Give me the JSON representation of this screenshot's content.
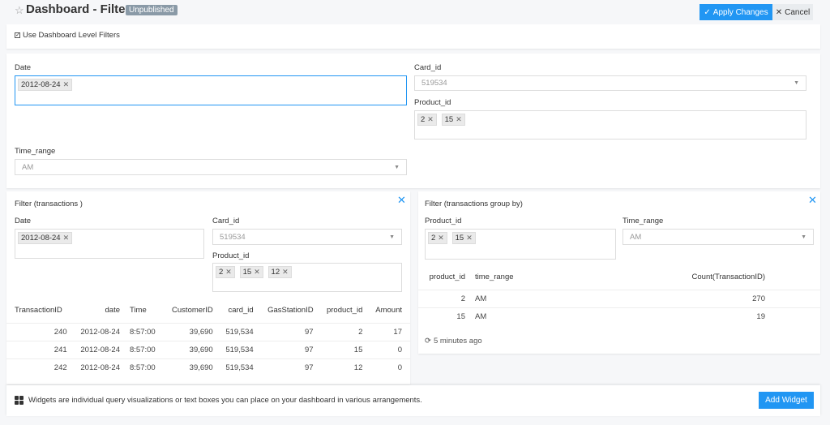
{
  "header": {
    "title": "Dashboard - Filter",
    "badge": "Unpublished",
    "apply_label": "Apply Changes",
    "cancel_label": "Cancel"
  },
  "dashboard_filters": {
    "checkbox_label": "Use Dashboard Level Filters",
    "date_label": "Date",
    "date_tags": [
      "2012-08-24"
    ],
    "card_id_label": "Card_id",
    "card_id_value": "519534",
    "product_id_label": "Product_id",
    "product_id_tags": [
      "2",
      "15"
    ],
    "time_range_label": "Time_range",
    "time_range_value": "AM"
  },
  "widget_left": {
    "title": "Filter (transactions )",
    "date_label": "Date",
    "date_tags": [
      "2012-08-24"
    ],
    "card_id_label": "Card_id",
    "card_id_value": "519534",
    "product_id_label": "Product_id",
    "product_id_tags": [
      "2",
      "15",
      "12"
    ],
    "columns": [
      "TransactionID",
      "date",
      "Time",
      "CustomerID",
      "card_id",
      "GasStationID",
      "product_id",
      "Amount"
    ],
    "rows": [
      [
        "240",
        "2012-08-24",
        "8:57:00",
        "39,690",
        "519,534",
        "97",
        "2",
        "17"
      ],
      [
        "241",
        "2012-08-24",
        "8:57:00",
        "39,690",
        "519,534",
        "97",
        "15",
        "0"
      ],
      [
        "242",
        "2012-08-24",
        "8:57:00",
        "39,690",
        "519,534",
        "97",
        "12",
        "0"
      ]
    ]
  },
  "widget_right": {
    "title": "Filter (transactions group by)",
    "product_id_label": "Product_id",
    "product_id_tags": [
      "2",
      "15"
    ],
    "time_range_label": "Time_range",
    "time_range_value": "AM",
    "columns": [
      "product_id",
      "time_range",
      "Count(TransactionID)"
    ],
    "rows": [
      [
        "2",
        "AM",
        "270"
      ],
      [
        "15",
        "AM",
        "19"
      ]
    ],
    "updated": "5 minutes ago"
  },
  "footer": {
    "message": "Widgets are individual query visualizations or text boxes you can place on your dashboard in various arrangements.",
    "add_label": "Add Widget"
  }
}
